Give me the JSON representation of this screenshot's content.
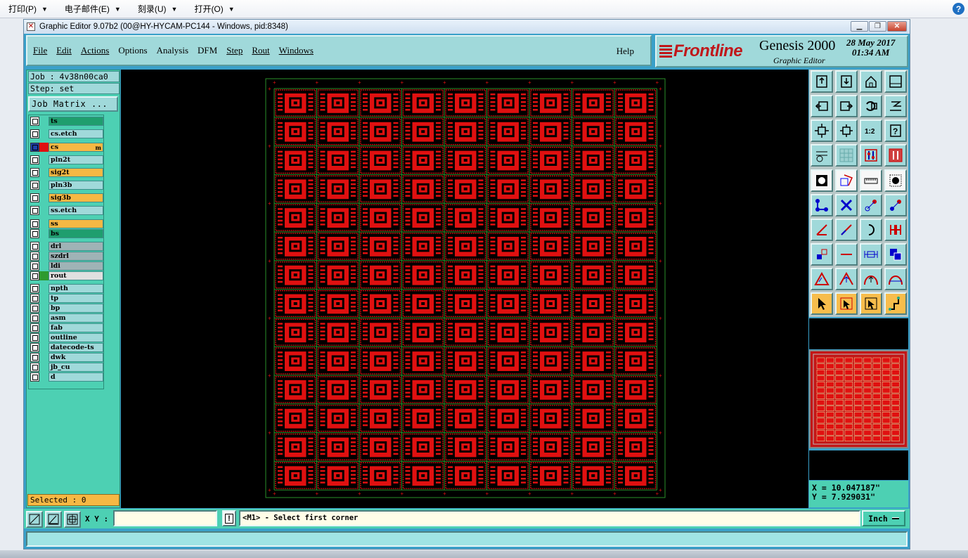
{
  "host_menubar": {
    "items": [
      {
        "label": "打印(P)"
      },
      {
        "label": "电子邮件(E)"
      },
      {
        "label": "刻录(U)"
      },
      {
        "label": "打开(O)"
      }
    ],
    "help_icon": "question-circle-icon",
    "help_glyph": "?"
  },
  "window": {
    "title": "Graphic Editor 9.07b2 (00@HY-HYCAM-PC144 - Windows, pid:8348)",
    "controls": {
      "minimize": "minimize-icon",
      "restore": "restore-icon",
      "close": "close-icon"
    }
  },
  "app_menu": {
    "items": [
      "File",
      "Edit",
      "Actions",
      "Options",
      "Analysis",
      "DFM",
      "Step",
      "Rout",
      "Windows"
    ],
    "help": "Help"
  },
  "brand": {
    "logo_text": "Frontline",
    "product": "Genesis 2000",
    "subtitle": "Graphic Editor",
    "date": "28 May 2017",
    "time": "01:34 AM"
  },
  "job": {
    "job_label": "Job : 4v38n00ca0",
    "step_label": "Step: set",
    "matrix_button": "Job Matrix ..."
  },
  "layers": [
    {
      "name": "ts",
      "bg": "#1f9e6e",
      "mark": ""
    },
    {
      "name": "cs.etch",
      "bg": "#a0d9da",
      "mark": ""
    },
    {
      "name": "cs",
      "bg": "#f6b844",
      "mark": "m",
      "work": true
    },
    {
      "name": "pln2t",
      "bg": "#a0d9da",
      "mark": ""
    },
    {
      "name": "sig2t",
      "bg": "#f6b844",
      "mark": ""
    },
    {
      "name": "pln3b",
      "bg": "#a0d9da",
      "mark": ""
    },
    {
      "name": "sig3b",
      "bg": "#f6b844",
      "mark": ""
    },
    {
      "name": "ss.etch",
      "bg": "#a0d9da",
      "mark": ""
    },
    {
      "name": "ss",
      "bg": "#f6b844",
      "mark": ""
    },
    {
      "name": "bs",
      "bg": "#1f9e6e",
      "mark": ""
    },
    {
      "name": "drl",
      "bg": "#9fb3b6",
      "mark": ""
    },
    {
      "name": "szdrl",
      "bg": "#9fb3b6",
      "mark": ""
    },
    {
      "name": "ldi",
      "bg": "#9fb3b6",
      "mark": ""
    },
    {
      "name": "rout",
      "bg": "#e0e0e0",
      "mark": "",
      "green": true
    },
    {
      "name": "npth",
      "bg": "#a0d9da",
      "mark": ""
    },
    {
      "name": "tp",
      "bg": "#a0d9da",
      "mark": ""
    },
    {
      "name": "bp",
      "bg": "#a0d9da",
      "mark": ""
    },
    {
      "name": "asm",
      "bg": "#a0d9da",
      "mark": ""
    },
    {
      "name": "fab",
      "bg": "#a0d9da",
      "mark": ""
    },
    {
      "name": "outline",
      "bg": "#a0d9da",
      "mark": ""
    },
    {
      "name": "datecode-ts",
      "bg": "#a0d9da",
      "mark": ""
    },
    {
      "name": "dwk",
      "bg": "#a0d9da",
      "mark": ""
    },
    {
      "name": "jb_cu",
      "bg": "#a0d9da",
      "mark": ""
    },
    {
      "name": "d",
      "bg": "#a0d9da",
      "mark": ""
    }
  ],
  "selection": {
    "label": "Selected : 0"
  },
  "panel": {
    "columns": 9,
    "rows": 14
  },
  "coords": {
    "x": "X = 10.047187\"",
    "y": "Y = 7.929031\""
  },
  "bottom": {
    "xy_label": "X Y :",
    "xy_value": "",
    "prompt": "<M1> - Select first corner",
    "unit": "Inch",
    "status": ""
  },
  "colors": {
    "copper": "#e01010",
    "board": "#000000",
    "outline": "#2a8f2a",
    "panel_bg": "#4dd0b3",
    "field_bg": "#a0d9da"
  },
  "toolbar_icons": [
    "open-job-icon",
    "open-step-icon",
    "home-icon",
    "window-icon",
    "zoom-back-icon",
    "zoom-forward-icon",
    "redraw-icon",
    "scale-icon",
    "zoom-fit-icon",
    "zoom-center-icon",
    "scale-1-2-icon",
    "help-query-icon",
    "properties-icon",
    "grid-icon",
    "layer-align-icon",
    "layer-align-red-icon",
    "select-pad-icon",
    "polygon-select-icon",
    "ruler-icon",
    "dotted-pad-icon",
    "net-select-icon",
    "cross-icon",
    "line-node-icon",
    "line-node2-icon",
    "angle-icon",
    "slash-icon",
    "arc-icon",
    "split-icon",
    "pad-move-icon",
    "line-icon",
    "dimension-icon",
    "copy-icon",
    "triangle-icon",
    "triangle-arrow-icon",
    "arch-icon",
    "arch-arrow-icon",
    "pointer-icon",
    "pointer-box-icon",
    "pointer-rotate-icon",
    "route-icon"
  ]
}
